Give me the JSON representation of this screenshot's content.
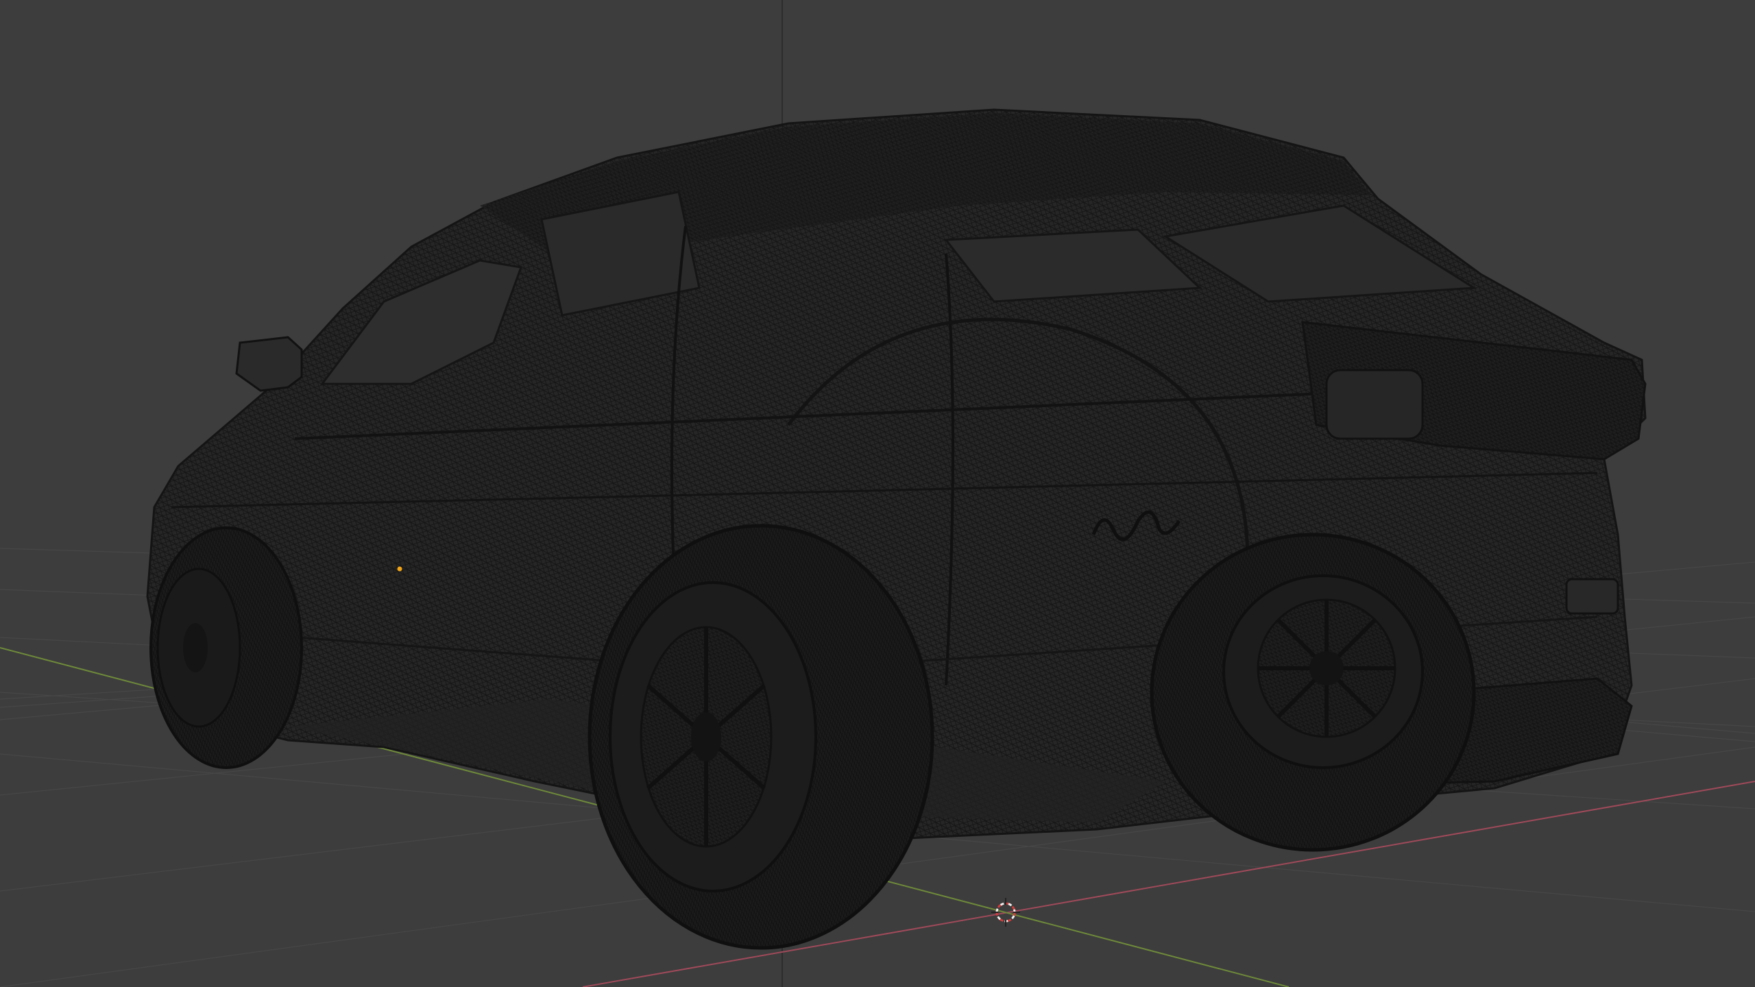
{
  "viewport": {
    "mode": "wireframe",
    "background_color": "#3d3d3d",
    "grid_color": "#4a4a4a",
    "x_axis_color": "#a04a5a",
    "y_axis_color": "#6e8a3a",
    "wireframe_color": "#141414",
    "origin_dot_color": "#f2a516",
    "cursor_colors": [
      "#d23c3c",
      "#f0f0f0"
    ]
  },
  "objects": [
    {
      "name": "car-mesh",
      "icon": "wireframe-car"
    },
    {
      "name": "3d-cursor",
      "icon": "crosshair-icon"
    },
    {
      "name": "object-origin",
      "icon": "origin-dot"
    }
  ]
}
